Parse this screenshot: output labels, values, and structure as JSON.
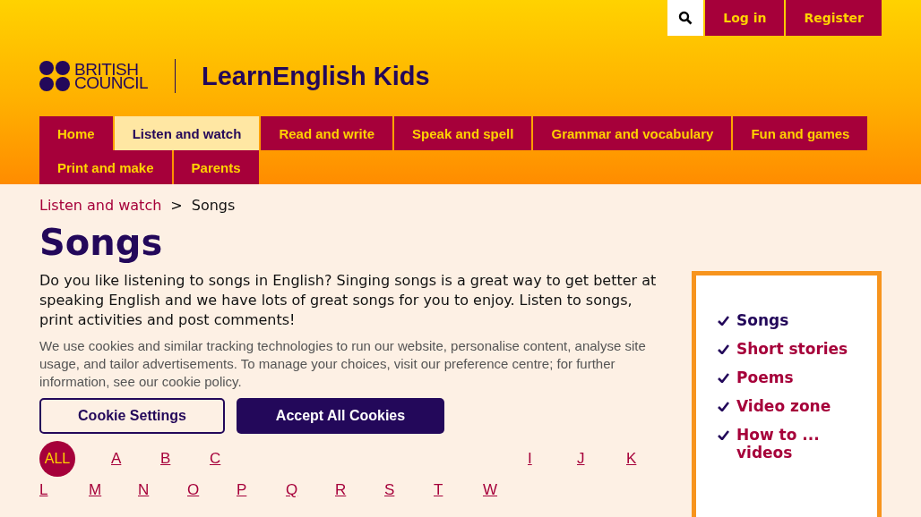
{
  "top_bar": {
    "buttons": [
      "Log in",
      "Register"
    ]
  },
  "logo": {
    "lines": [
      "BRITISH",
      "COUNCIL"
    ]
  },
  "site_title": "LearnEnglish Kids",
  "nav": [
    {
      "label": "Home",
      "selected": false
    },
    {
      "label": "Listen and watch",
      "selected": true
    },
    {
      "label": "Read and write",
      "selected": false
    },
    {
      "label": "Speak and spell",
      "selected": false
    },
    {
      "label": "Grammar and vocabulary",
      "selected": false
    },
    {
      "label": "Fun and games",
      "selected": false
    },
    {
      "label": "Print and make",
      "selected": false
    },
    {
      "label": "Parents",
      "selected": false
    }
  ],
  "breadcrumb": {
    "link": "Listen and watch",
    "separator": ">",
    "current": "Songs"
  },
  "heading": "Songs",
  "intro": "Do you like listening to songs in English? Singing songs is a great way to get better at speaking English and we have lots of great songs for you to enjoy. Listen to songs, print activities and post comments!",
  "alphabet": {
    "all": "ALL",
    "row_1_left": [
      "A",
      "B",
      "C"
    ],
    "row_1_right": [
      "I",
      "J",
      "K"
    ],
    "row_2": [
      "L",
      "M",
      "N",
      "O",
      "P",
      "Q",
      "R",
      "S",
      "T",
      "W"
    ]
  },
  "sidebar": [
    {
      "label": "Songs",
      "selected": true
    },
    {
      "label": "Short stories",
      "selected": false
    },
    {
      "label": "Poems",
      "selected": false
    },
    {
      "label": "Video zone",
      "selected": false
    },
    {
      "label": "How to ... videos",
      "selected": false
    }
  ],
  "cookie_banner": {
    "text": "We use cookies and similar tracking technologies to run our website, personalise content, analyse site usage, and tailor advertisements. To manage your choices, visit our preference centre; for further information, see our cookie policy.",
    "settings_button": "Cookie Settings",
    "accept_button": "Accept All Cookies"
  }
}
